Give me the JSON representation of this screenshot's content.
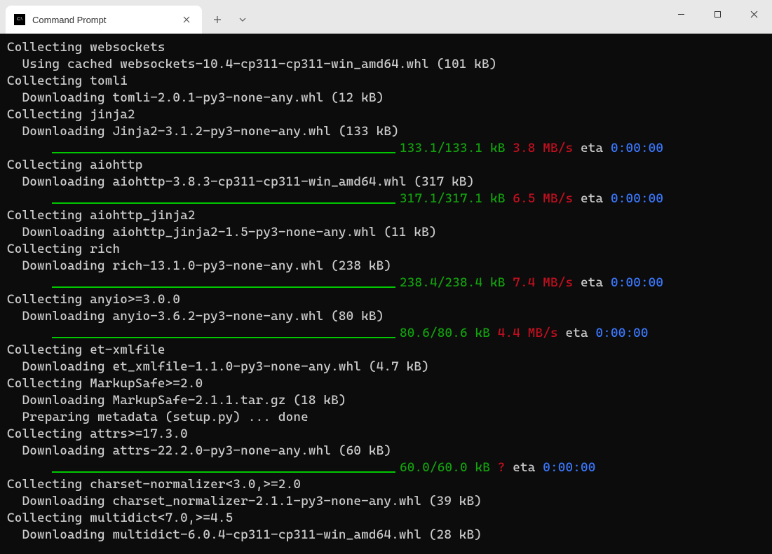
{
  "window": {
    "tab_title": "Command Prompt"
  },
  "lines": [
    {
      "type": "text",
      "text": "Collecting websockets"
    },
    {
      "type": "text",
      "text": "  Using cached websockets-10.4-cp311-cp311-win_amd64.whl (101 kB)"
    },
    {
      "type": "text",
      "text": "Collecting tomli"
    },
    {
      "type": "text",
      "text": "  Downloading tomli-2.0.1-py3-none-any.whl (12 kB)"
    },
    {
      "type": "text",
      "text": "Collecting jinja2"
    },
    {
      "type": "text",
      "text": "  Downloading Jinja2-3.1.2-py3-none-any.whl (133 kB)"
    },
    {
      "type": "progress",
      "size": "133.1/133.1 kB",
      "speed": "3.8 MB/s",
      "eta_label": "eta",
      "eta": "0:00:00"
    },
    {
      "type": "text",
      "text": "Collecting aiohttp"
    },
    {
      "type": "text",
      "text": "  Downloading aiohttp-3.8.3-cp311-cp311-win_amd64.whl (317 kB)"
    },
    {
      "type": "progress",
      "size": "317.1/317.1 kB",
      "speed": "6.5 MB/s",
      "eta_label": "eta",
      "eta": "0:00:00"
    },
    {
      "type": "text",
      "text": "Collecting aiohttp_jinja2"
    },
    {
      "type": "text",
      "text": "  Downloading aiohttp_jinja2-1.5-py3-none-any.whl (11 kB)"
    },
    {
      "type": "text",
      "text": "Collecting rich"
    },
    {
      "type": "text",
      "text": "  Downloading rich-13.1.0-py3-none-any.whl (238 kB)"
    },
    {
      "type": "progress",
      "size": "238.4/238.4 kB",
      "speed": "7.4 MB/s",
      "eta_label": "eta",
      "eta": "0:00:00"
    },
    {
      "type": "text",
      "text": "Collecting anyio>=3.0.0"
    },
    {
      "type": "text",
      "text": "  Downloading anyio-3.6.2-py3-none-any.whl (80 kB)"
    },
    {
      "type": "progress",
      "size": "80.6/80.6 kB",
      "speed": "4.4 MB/s",
      "eta_label": "eta",
      "eta": "0:00:00"
    },
    {
      "type": "text",
      "text": "Collecting et-xmlfile"
    },
    {
      "type": "text",
      "text": "  Downloading et_xmlfile-1.1.0-py3-none-any.whl (4.7 kB)"
    },
    {
      "type": "text",
      "text": "Collecting MarkupSafe>=2.0"
    },
    {
      "type": "text",
      "text": "  Downloading MarkupSafe-2.1.1.tar.gz (18 kB)"
    },
    {
      "type": "text",
      "text": "  Preparing metadata (setup.py) ... done"
    },
    {
      "type": "text",
      "text": "Collecting attrs>=17.3.0"
    },
    {
      "type": "text",
      "text": "  Downloading attrs-22.2.0-py3-none-any.whl (60 kB)"
    },
    {
      "type": "progress",
      "size": "60.0/60.0 kB",
      "speed": "?",
      "eta_label": "eta",
      "eta": "0:00:00"
    },
    {
      "type": "text",
      "text": "Collecting charset-normalizer<3.0,>=2.0"
    },
    {
      "type": "text",
      "text": "  Downloading charset_normalizer-2.1.1-py3-none-any.whl (39 kB)"
    },
    {
      "type": "text",
      "text": "Collecting multidict<7.0,>=4.5"
    },
    {
      "type": "text",
      "text": "  Downloading multidict-6.0.4-cp311-cp311-win_amd64.whl (28 kB)"
    }
  ]
}
